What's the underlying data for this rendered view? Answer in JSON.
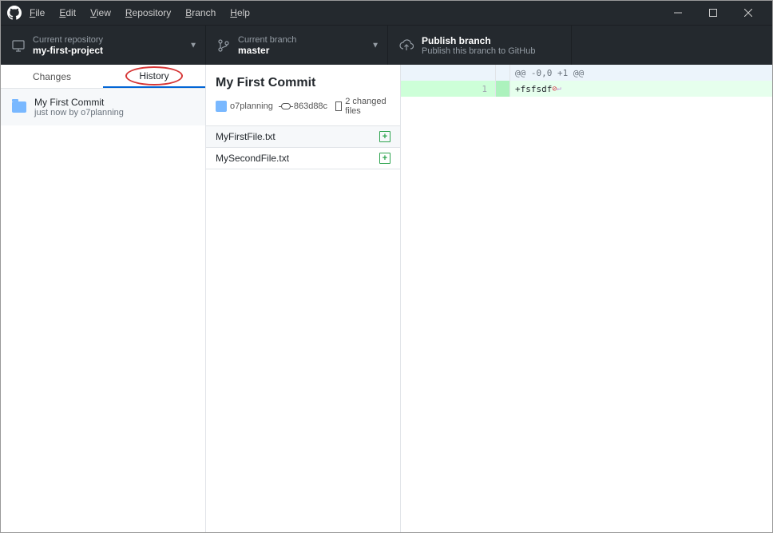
{
  "menubar": {
    "file": "File",
    "edit": "Edit",
    "view": "View",
    "repository": "Repository",
    "branch": "Branch",
    "help": "Help"
  },
  "toolbar": {
    "repo_label": "Current repository",
    "repo_value": "my-first-project",
    "branch_label": "Current branch",
    "branch_value": "master",
    "publish_title": "Publish branch",
    "publish_sub": "Publish this branch to GitHub"
  },
  "tabs": {
    "changes": "Changes",
    "history": "History"
  },
  "commit_list": [
    {
      "title": "My First Commit",
      "meta": "just now by o7planning"
    }
  ],
  "commit_detail": {
    "title": "My First Commit",
    "author": "o7planning",
    "sha": "863d88c",
    "files_label": "2 changed files",
    "files": [
      {
        "name": "MyFirstFile.txt"
      },
      {
        "name": "MySecondFile.txt"
      }
    ]
  },
  "diff": {
    "hunk": "@@ -0,0 +1 @@",
    "line_no": "1",
    "added_prefix": "+",
    "added_text": "fsfsdf"
  }
}
